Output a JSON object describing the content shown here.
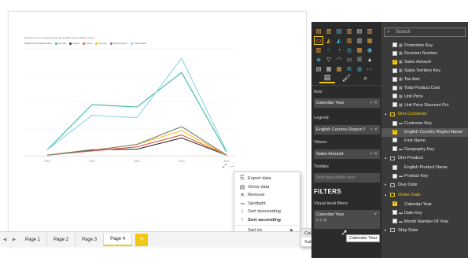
{
  "chart_data": {
    "type": "line",
    "title": "Sales Amount by Calendar Year and English Country Region Name",
    "legend_title": "English Country Region Name",
    "x": [
      "2010",
      "2011",
      "2012",
      "2013",
      "2014"
    ],
    "series": [
      {
        "name": "Australia",
        "color": "#3ab7a7",
        "values": [
          0.5,
          4.3,
          4.1,
          7.0,
          0.3
        ]
      },
      {
        "name": "Canada",
        "color": "#333333",
        "values": [
          0.05,
          0.5,
          0.55,
          1.5,
          0.05
        ]
      },
      {
        "name": "France",
        "color": "#e8543a",
        "values": [
          0.05,
          0.4,
          0.75,
          1.75,
          0.05
        ]
      },
      {
        "name": "Germany",
        "color": "#f2c811",
        "values": [
          0.05,
          0.45,
          0.95,
          2.1,
          0.05
        ]
      },
      {
        "name": "United Kingdom",
        "color": "#777777",
        "values": [
          0.05,
          0.45,
          0.95,
          2.45,
          0.05
        ]
      },
      {
        "name": "United States",
        "color": "#8ad4eb",
        "values": [
          0.5,
          3.4,
          3.2,
          8.2,
          0.4
        ]
      }
    ],
    "ylim": [
      0,
      9
    ],
    "grid": true,
    "legend_position": "top-left"
  },
  "context_menu": {
    "items": [
      {
        "icon": "export-data-icon",
        "glyph": "⎘",
        "label": "Export data"
      },
      {
        "icon": "show-data-icon",
        "glyph": "▤",
        "label": "Show data"
      },
      {
        "icon": "remove-icon",
        "glyph": "✕",
        "label": "Remove"
      },
      {
        "icon": "spotlight-icon",
        "glyph": "⊸",
        "label": "Spotlight"
      },
      {
        "icon": "sort-descending-icon",
        "glyph": "↓",
        "label": "Sort descending"
      },
      {
        "icon": "sort-ascending-icon",
        "glyph": "↑",
        "label": "Sort ascending"
      }
    ],
    "sort_by_label": "Sort by",
    "sort_by_options": [
      "Calendar Year",
      "Sales Amount"
    ],
    "tooltip": "Calendar Year"
  },
  "pages": {
    "tabs": [
      "Page 1",
      "Page 2",
      "Page 3",
      "Page 4"
    ],
    "active": "Page 4",
    "add_label": "+"
  },
  "visualizations": {
    "icons": [
      {
        "name": "stacked-bar-icon",
        "glyph": "▤",
        "color": "#e9a23b"
      },
      {
        "name": "stacked-column-icon",
        "glyph": "▥",
        "color": "#e9a23b"
      },
      {
        "name": "clustered-bar-icon",
        "glyph": "▤",
        "color": "#4ab8d8"
      },
      {
        "name": "clustered-column-icon",
        "glyph": "▥",
        "color": "#e9a23b"
      },
      {
        "name": "percent-bar-icon",
        "glyph": "▤",
        "color": "#cccccc"
      },
      {
        "name": "percent-column-icon",
        "glyph": "▥",
        "color": "#e9a23b"
      },
      {
        "name": "line-chart-icon",
        "glyph": "▭",
        "color": "#e9a23b"
      },
      {
        "name": "area-chart-icon",
        "glyph": "◭",
        "color": "#e9a23b"
      },
      {
        "name": "stacked-area-icon",
        "glyph": "◭",
        "color": "#4ab8d8"
      },
      {
        "name": "line-column-icon",
        "glyph": "▥",
        "color": "#e9a23b"
      },
      {
        "name": "line-stacked-icon",
        "glyph": "▥",
        "color": "#cccccc"
      },
      {
        "name": "ribbon-chart-icon",
        "glyph": "▦",
        "color": "#e9a23b"
      },
      {
        "name": "waterfall-icon",
        "glyph": "▥",
        "color": "#e9a23b"
      },
      {
        "name": "scatter-icon",
        "glyph": "⁘",
        "color": "#4ab8d8"
      },
      {
        "name": "pie-chart-icon",
        "glyph": "◔",
        "color": "#e9a23b"
      },
      {
        "name": "donut-icon",
        "glyph": "◎",
        "color": "#4ab8d8"
      },
      {
        "name": "treemap-icon",
        "glyph": "▦",
        "color": "#e9a23b"
      },
      {
        "name": "map-icon",
        "glyph": "◉",
        "color": "#4ab8d8"
      },
      {
        "name": "filled-map-icon",
        "glyph": "◈",
        "color": "#4ab8d8"
      },
      {
        "name": "funnel-icon",
        "glyph": "▽",
        "color": "#cccccc"
      },
      {
        "name": "gauge-icon",
        "glyph": "◠",
        "color": "#cccccc"
      },
      {
        "name": "card-icon",
        "glyph": "▭",
        "color": "#cccccc"
      },
      {
        "name": "multi-row-card-icon",
        "glyph": "☰",
        "color": "#cccccc"
      },
      {
        "name": "kpi-icon",
        "glyph": "▲",
        "color": "#cccccc"
      },
      {
        "name": "slicer-icon",
        "glyph": "▤",
        "color": "#cccccc"
      },
      {
        "name": "table-icon",
        "glyph": "▦",
        "color": "#cccccc"
      },
      {
        "name": "matrix-icon",
        "glyph": "▦",
        "color": "#e9a23b"
      },
      {
        "name": "r-visual-icon",
        "glyph": "R",
        "color": "#4ab8d8"
      },
      {
        "name": "globe-icon",
        "glyph": "◍",
        "color": "#4ab8d8"
      },
      {
        "name": "more-visuals-icon",
        "glyph": "⋯",
        "color": "#cccccc"
      }
    ],
    "tabs": [
      {
        "name": "fields-tab-icon",
        "glyph": "▤"
      },
      {
        "name": "format-tab-icon",
        "glyph": "🖌"
      },
      {
        "name": "analytics-tab-icon",
        "glyph": "⌕"
      }
    ],
    "axis_label": "Axis",
    "axis_value": "Calendar Year",
    "legend_label": "Legend",
    "legend_value": "English Country Region Name",
    "values_label": "Values",
    "values_value": "Sales Amount",
    "tooltips_label": "Tooltips",
    "tooltips_placeholder": "Add data fields here",
    "filters_title": "FILTERS",
    "visual_filters_label": "Visual level filters",
    "filter_name": "Calendar Year",
    "filter_sub": "is (All)"
  },
  "fields": {
    "search_placeholder": "Search",
    "rows": [
      {
        "type": "field",
        "label": "Promotion Key",
        "checked": false,
        "icon": "▦"
      },
      {
        "type": "field",
        "label": "Revision Number",
        "checked": false,
        "icon": "▦"
      },
      {
        "type": "field",
        "label": "Sales Amount",
        "checked": true,
        "icon": "▦"
      },
      {
        "type": "field",
        "label": "Sales Territory Key",
        "checked": false,
        "icon": "▦"
      },
      {
        "type": "field",
        "label": "Tax Amt",
        "checked": false,
        "icon": "▦"
      },
      {
        "type": "field",
        "label": "Total Product Cost",
        "checked": false,
        "icon": "▦"
      },
      {
        "type": "field",
        "label": "Unit Price",
        "checked": false,
        "icon": "▦"
      },
      {
        "type": "field",
        "label": "Unit Price Discount Pct",
        "checked": false,
        "icon": "▦"
      },
      {
        "type": "table",
        "label": "Dim Customer",
        "hot": true,
        "open": true
      },
      {
        "type": "field",
        "label": "Customer Key",
        "checked": false,
        "icon": "▬"
      },
      {
        "type": "field",
        "label": "English Country Region Name",
        "checked": true,
        "icon": "",
        "selected": true
      },
      {
        "type": "field",
        "label": "First Name",
        "checked": false,
        "icon": ""
      },
      {
        "type": "field",
        "label": "Geography Key",
        "checked": false,
        "icon": "▬"
      },
      {
        "type": "table",
        "label": "Dim Product",
        "hot": false,
        "open": true
      },
      {
        "type": "field",
        "label": "English Product Name",
        "checked": false,
        "icon": ""
      },
      {
        "type": "field",
        "label": "Product Key",
        "checked": false,
        "icon": "▬"
      },
      {
        "type": "table",
        "label": "Due Date",
        "hot": false,
        "open": false
      },
      {
        "type": "table",
        "label": "Order Date",
        "hot": true,
        "open": true
      },
      {
        "type": "field",
        "label": "Calendar Year",
        "checked": true,
        "icon": ""
      },
      {
        "type": "field",
        "label": "Date Key",
        "checked": false,
        "icon": "▬"
      },
      {
        "type": "field",
        "label": "Month Number Of Year",
        "checked": false,
        "icon": "▬"
      },
      {
        "type": "table",
        "label": "Ship Date",
        "hot": false,
        "open": false
      }
    ]
  }
}
